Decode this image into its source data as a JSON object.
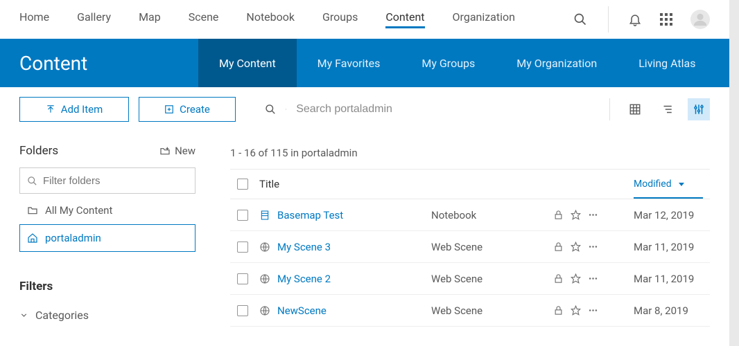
{
  "colors": {
    "accent": "#0079c1",
    "accent_dark": "#00598e"
  },
  "topnav": {
    "items": [
      {
        "label": "Home"
      },
      {
        "label": "Gallery"
      },
      {
        "label": "Map"
      },
      {
        "label": "Scene"
      },
      {
        "label": "Notebook"
      },
      {
        "label": "Groups"
      },
      {
        "label": "Content"
      },
      {
        "label": "Organization"
      }
    ],
    "active_index": 6
  },
  "bluebar": {
    "title": "Content",
    "tabs": [
      {
        "label": "My Content"
      },
      {
        "label": "My Favorites"
      },
      {
        "label": "My Groups"
      },
      {
        "label": "My Organization"
      },
      {
        "label": "Living Atlas"
      }
    ],
    "active_index": 0
  },
  "actions": {
    "add_item": "Add Item",
    "create": "Create",
    "search_placeholder": "Search portaladmin"
  },
  "folders": {
    "title": "Folders",
    "new_label": "New",
    "filter_placeholder": "Filter folders",
    "items": [
      {
        "label": "All My Content",
        "icon": "folder"
      },
      {
        "label": "portaladmin",
        "icon": "home"
      }
    ],
    "selected_index": 1
  },
  "filters": {
    "title": "Filters",
    "categories_label": "Categories"
  },
  "results": {
    "count_text": "1 - 16 of 115 in portaladmin",
    "col_title": "Title",
    "col_modified": "Modified",
    "rows": [
      {
        "title": "Basemap Test",
        "type": "Notebook",
        "modified": "Mar 12, 2019",
        "icon": "notebook"
      },
      {
        "title": "My Scene 3",
        "type": "Web Scene",
        "modified": "Mar 11, 2019",
        "icon": "globe"
      },
      {
        "title": "My Scene 2",
        "type": "Web Scene",
        "modified": "Mar 11, 2019",
        "icon": "globe"
      },
      {
        "title": "NewScene",
        "type": "Web Scene",
        "modified": "Mar 8, 2019",
        "icon": "globe"
      }
    ]
  }
}
